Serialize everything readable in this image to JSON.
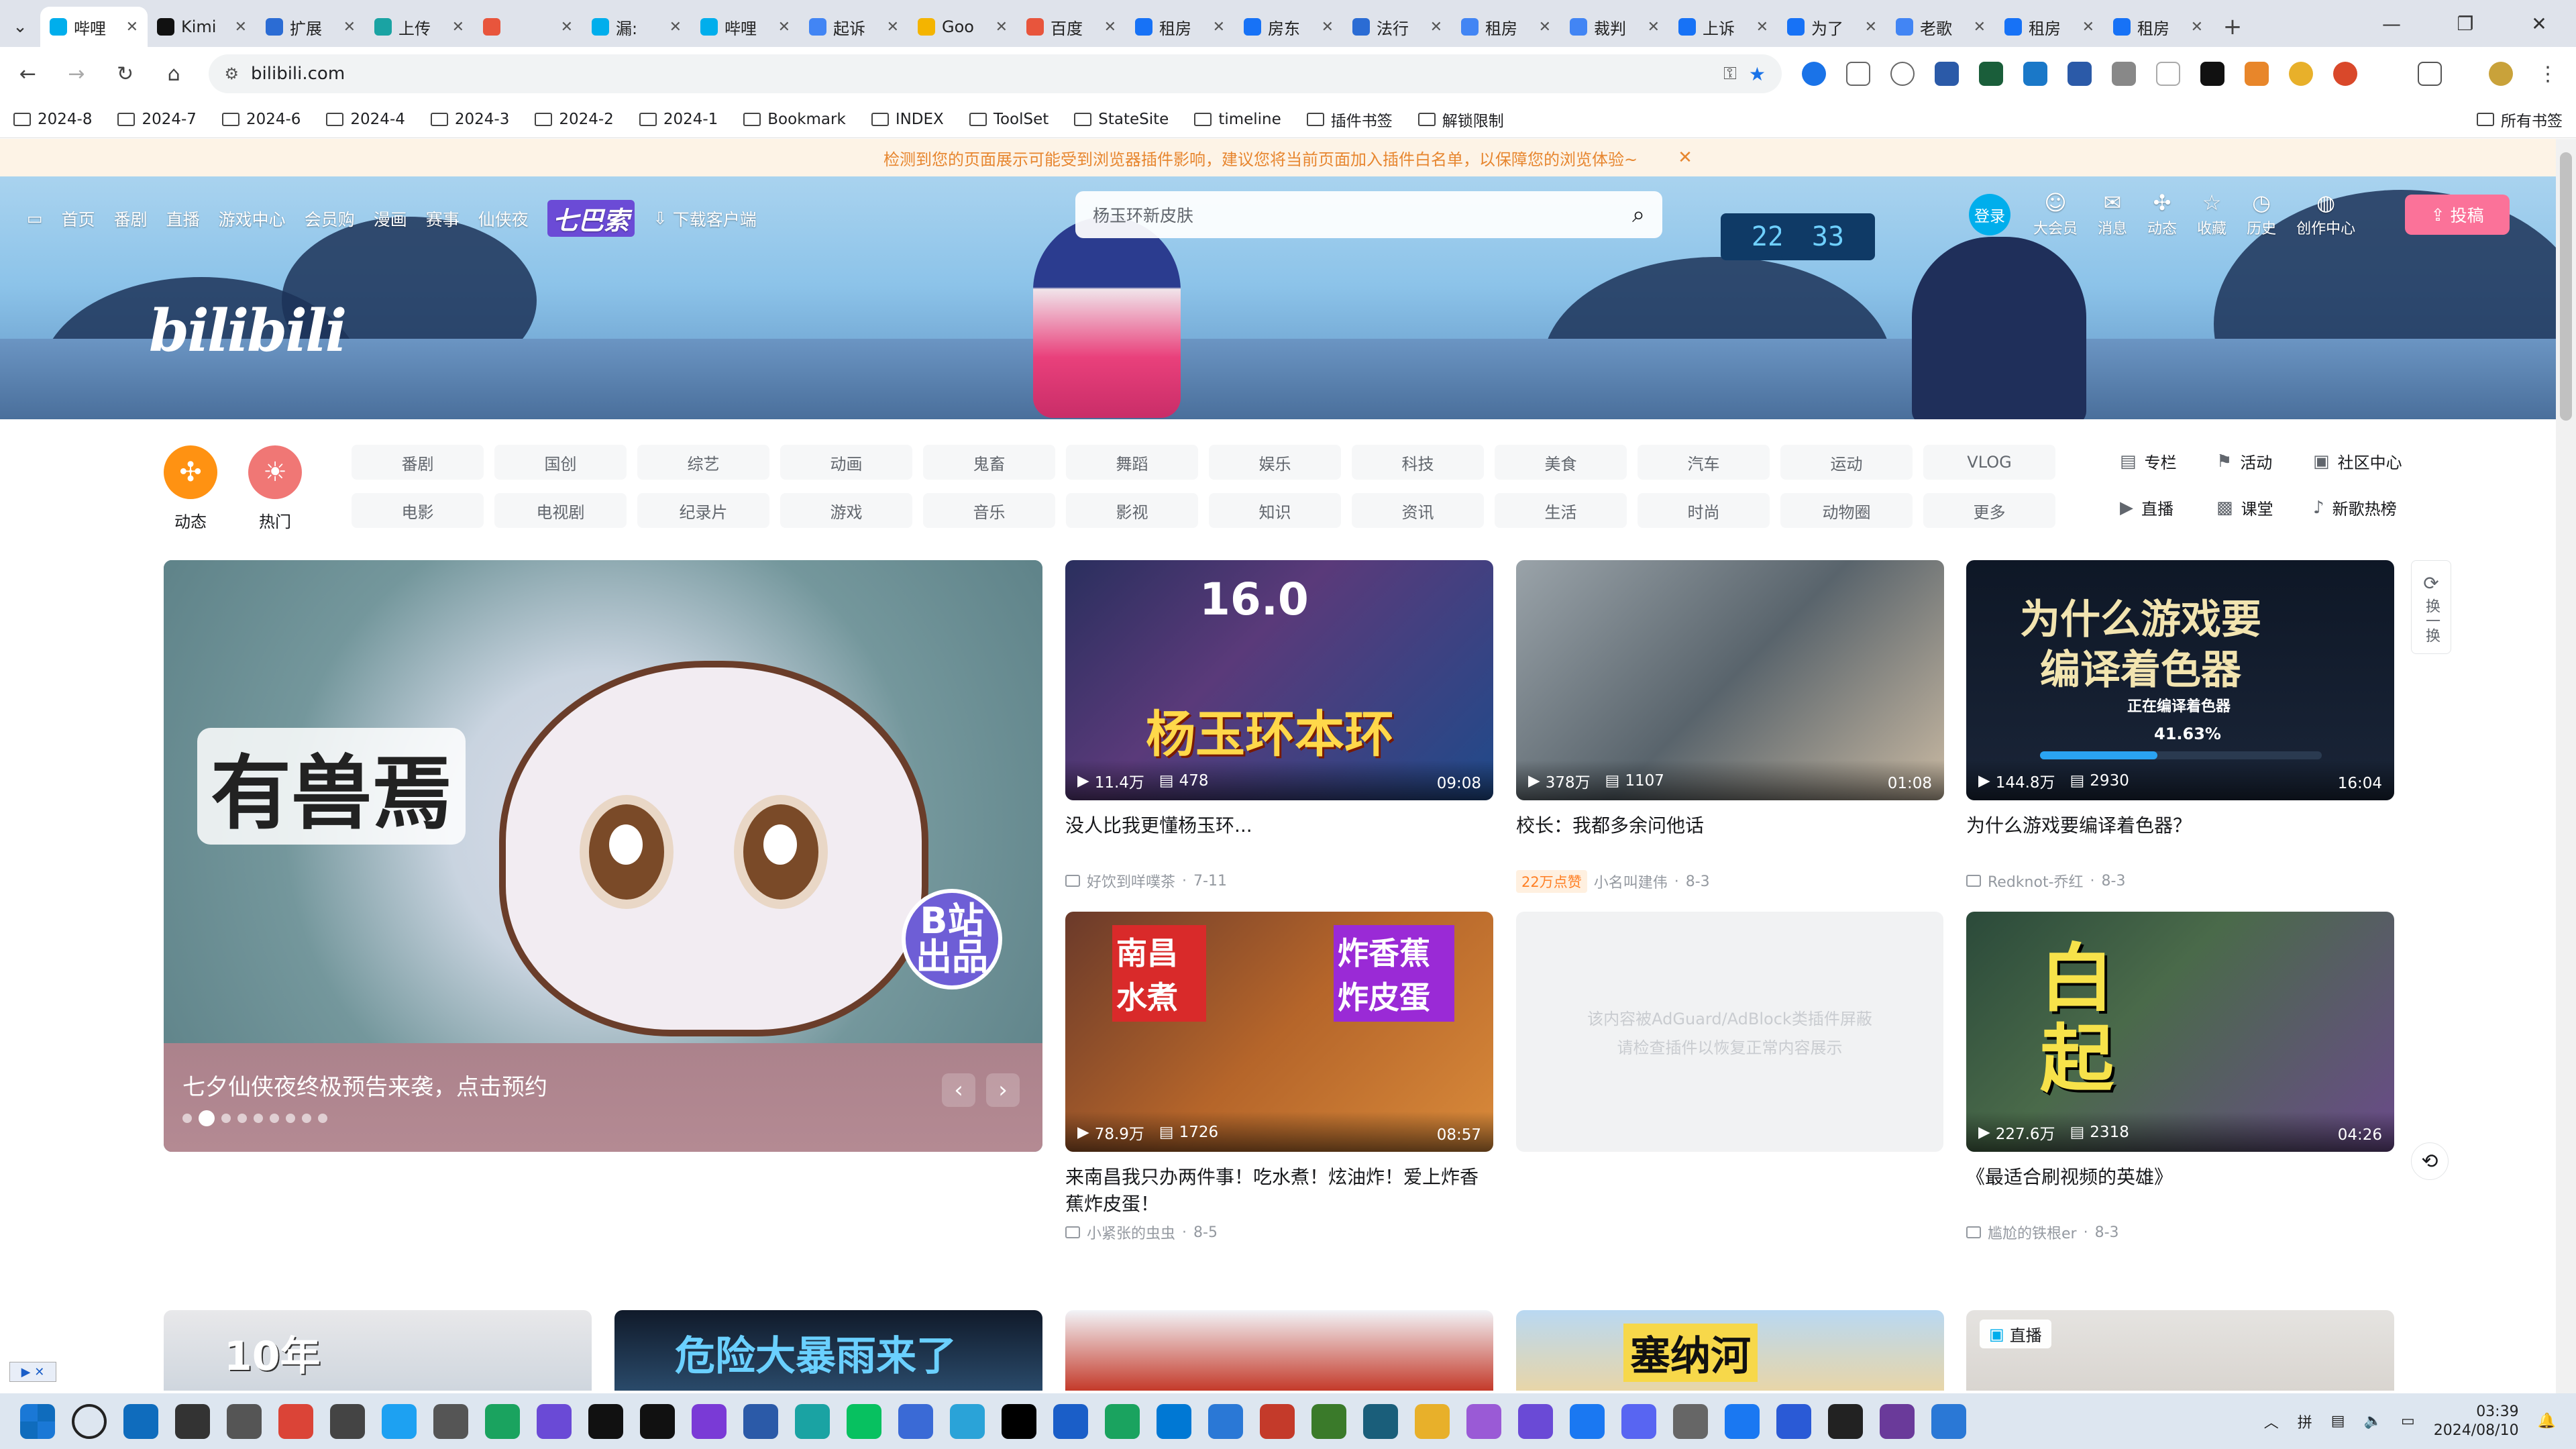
{
  "browser": {
    "tabs": [
      {
        "label": "哔哩",
        "color": "#00aeec",
        "active": true
      },
      {
        "label": "Kimi",
        "color": "#111111"
      },
      {
        "label": "扩展",
        "color": "#2b6cd4"
      },
      {
        "label": "上传",
        "color": "#1aa3a3"
      },
      {
        "label": "",
        "color": "#e8553c"
      },
      {
        "label": "漏:",
        "color": "#00aeec"
      },
      {
        "label": "哔哩",
        "color": "#00aeec"
      },
      {
        "label": "起诉",
        "color": "#4285f4"
      },
      {
        "label": "Goo",
        "color": "#f4b400"
      },
      {
        "label": "百度",
        "color": "#e8553c"
      },
      {
        "label": "租房",
        "color": "#1772f6"
      },
      {
        "label": "房东",
        "color": "#1772f6"
      },
      {
        "label": "法行",
        "color": "#2b6cd4"
      },
      {
        "label": "租房",
        "color": "#4285f4"
      },
      {
        "label": "裁判",
        "color": "#4285f4"
      },
      {
        "label": "上诉",
        "color": "#1772f6"
      },
      {
        "label": "为了",
        "color": "#1772f6"
      },
      {
        "label": "老歌",
        "color": "#4285f4"
      },
      {
        "label": "租房",
        "color": "#1772f6"
      },
      {
        "label": "租房",
        "color": "#1772f6"
      }
    ],
    "url": "bilibili.com",
    "bookmarks": [
      "2024-8",
      "2024-7",
      "2024-6",
      "2024-4",
      "2024-3",
      "2024-2",
      "2024-1",
      "Bookmark",
      "INDEX",
      "ToolSet",
      "StateSite",
      "timeline",
      "插件书签",
      "解锁限制"
    ],
    "bookmarks_right": "所有书签"
  },
  "warning": "检测到您的页面展示可能受到浏览器插件影响，建议您将当前页面加入插件白名单，以保障您的浏览体验~",
  "header": {
    "nav": [
      "首页",
      "番剧",
      "直播",
      "游戏中心",
      "会员购",
      "漫画",
      "赛事",
      "仙侠夜"
    ],
    "promo_badge": "七巴索",
    "download": "下载客户端",
    "logo": "bilibili",
    "search_placeholder": "杨玉环新皮肤",
    "login": "登录",
    "right_nav": [
      {
        "label": "大会员",
        "icon": "☺"
      },
      {
        "label": "消息",
        "icon": "✉"
      },
      {
        "label": "动态",
        "icon": "✣"
      },
      {
        "label": "收藏",
        "icon": "☆"
      },
      {
        "label": "历史",
        "icon": "◷"
      },
      {
        "label": "创作中心",
        "icon": "◍"
      }
    ],
    "upload": "投稿",
    "sign_left": "22",
    "sign_right": "33"
  },
  "channels": {
    "circles": [
      {
        "label": "动态",
        "icon": "✣",
        "color": "#ff9212"
      },
      {
        "label": "热门",
        "icon": "☀",
        "color": "#f07775"
      }
    ],
    "grid": [
      "番剧",
      "国创",
      "综艺",
      "动画",
      "鬼畜",
      "舞蹈",
      "娱乐",
      "科技",
      "美食",
      "汽车",
      "运动",
      "VLOG",
      "电影",
      "电视剧",
      "纪录片",
      "游戏",
      "音乐",
      "影视",
      "知识",
      "资讯",
      "生活",
      "时尚",
      "动物圈",
      "更多"
    ],
    "side": [
      {
        "label": "专栏",
        "icon": "▤"
      },
      {
        "label": "活动",
        "icon": "⚑"
      },
      {
        "label": "社区中心",
        "icon": "▣"
      },
      {
        "label": "直播",
        "icon": "▶"
      },
      {
        "label": "课堂",
        "icon": "▩"
      },
      {
        "label": "新歌热榜",
        "icon": "♪"
      }
    ]
  },
  "carousel": {
    "caption": "七夕仙侠夜终极预告来袭，点击预约",
    "art_title": "有兽焉",
    "badge": "B站出品",
    "dot_count": 9,
    "active_dot": 1
  },
  "videos": [
    {
      "title": "没人比我更懂杨玉环...",
      "views": "11.4万",
      "danmaku": "478",
      "duration": "09:08",
      "up": "好饮到咩噗茶",
      "date": "7-11",
      "hot": "",
      "bg": "linear-gradient(135deg,#2a2f5e,#5a3a7a 40%,#1f4a8a)",
      "text": "杨玉环本环",
      "text2": "16.0",
      "text_color": "#ffd84a"
    },
    {
      "title": "校长：我都多余问他话",
      "views": "378万",
      "danmaku": "1107",
      "duration": "01:08",
      "up": "小名叫建伟",
      "date": "8-3",
      "hot": "22万点赞",
      "bg": "linear-gradient(135deg,#9aa3a9,#59646c 50%,#c9b9a2)",
      "text": "",
      "text2": "",
      "text_color": "#ffffff"
    },
    {
      "title": "为什么游戏要编译着色器？",
      "views": "144.8万",
      "danmaku": "2930",
      "duration": "16:04",
      "up": "Redknot-乔红",
      "date": "8-3",
      "hot": "",
      "bg": "linear-gradient(180deg,#0e1726,#1a2538)",
      "text": "为什么游戏要",
      "text2": "编译着色器",
      "text_color": "#f2e4b0",
      "progress_label": "正在编译着色器",
      "progress": "41.63%",
      "progress_fraction": 0.4163
    },
    {
      "title": "来南昌我只办两件事！吃水煮！炫油炸！爱上炸香蕉炸皮蛋！",
      "views": "78.9万",
      "danmaku": "1726",
      "duration": "08:57",
      "up": "小紧张的虫虫",
      "date": "8-5",
      "hot": "",
      "bg": "linear-gradient(135deg,#6b3a2a,#b5652a 50%,#d98a3a)",
      "text": "南昌 水煮",
      "text2": "炸香蕉 炸皮蛋",
      "text_color": "#ffffff"
    },
    {
      "title": "《最适合刷视频的英雄》",
      "views": "227.6万",
      "danmaku": "2318",
      "duration": "04:26",
      "up": "尴尬的铁根er",
      "date": "8-3",
      "hot": "",
      "bg": "linear-gradient(135deg,#2b4a3a,#4a6a4a 40%,#6a4a8a)",
      "text": "白起",
      "text2": "",
      "text_color": "#f7e24a"
    }
  ],
  "blocked": {
    "line1": "该内容被AdGuard/AdBlock类插件屏蔽",
    "line2": "请检查插件以恢复正常内容展示"
  },
  "refresh_label": "换一换",
  "row3": [
    {
      "bg": "linear-gradient(180deg,#e8e8ea,#cfd6de)",
      "text": "10年"
    },
    {
      "bg": "linear-gradient(180deg,#101a2a,#2a4a6a)",
      "text": "危险大暴雨来了"
    },
    {
      "bg": "linear-gradient(180deg,#f2f4f8,#c43a2a)",
      "text": ""
    },
    {
      "bg": "linear-gradient(180deg,#b9d8f2,#e8d6a8)",
      "text": "塞纳河"
    },
    {
      "bg": "linear-gradient(180deg,#e5e3e0,#d9d5d0)",
      "text": "",
      "live": "直播"
    }
  ],
  "taskbar": {
    "time": "03:39",
    "date": "2024/08/10",
    "apps": [
      "#0f6cbd",
      "#333333",
      "#555555",
      "#db4437",
      "#444444",
      "#1da1f2",
      "#555555",
      "#1aa35f",
      "#6a4ad6",
      "#111111",
      "#111111",
      "#7a3ad6",
      "#2b5aa8",
      "#1aa3a3",
      "#07c160",
      "#3a6ad6",
      "#2aa3d8",
      "#000000",
      "#1a5ec8",
      "#1aa35f",
      "#0078d4",
      "#2a78d6",
      "#c43a2a",
      "#3a7a2a",
      "#1a5e7a",
      "#e8b02a",
      "#9a5ad6",
      "#6a4ad6",
      "#1a78f2",
      "#5865f2",
      "#666666",
      "#1a78f2",
      "#2a5ad6",
      "#222222",
      "#6a3a9a",
      "#2a78d6"
    ]
  }
}
